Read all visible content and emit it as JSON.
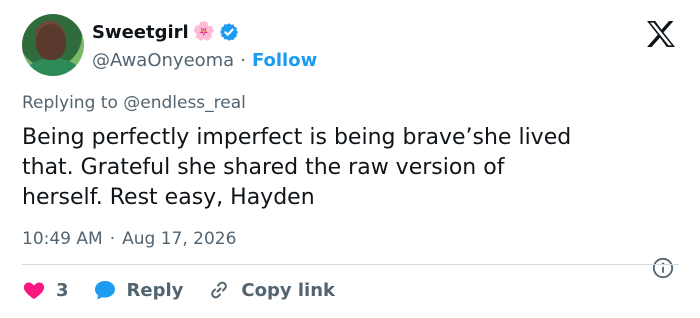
{
  "author": {
    "display_name": "Sweetgirl",
    "name_emoji": "🌸",
    "handle": "@AwaOnyeoma",
    "separator": "·",
    "follow_label": "Follow",
    "verified": true
  },
  "tweet": {
    "replying_to": "Replying to @endless_real",
    "text": "Being perfectly imperfect is being brave’she lived\nthat. Grateful she shared the raw version of\nherself. Rest easy, Hayden",
    "time": "10:49 AM",
    "meta_separator": "·",
    "date": "Aug 17, 2026"
  },
  "actions": {
    "like_count": "3",
    "reply_label": "Reply",
    "copy_link_label": "Copy link"
  },
  "colors": {
    "accent": "#1d9bf0",
    "like": "#f91880",
    "text": "#0f1419",
    "muted": "#536471"
  },
  "icons": [
    "avatar",
    "flower-icon",
    "verified-icon",
    "x-logo-icon",
    "info-icon",
    "heart-icon",
    "reply-bubble-icon",
    "link-icon"
  ]
}
